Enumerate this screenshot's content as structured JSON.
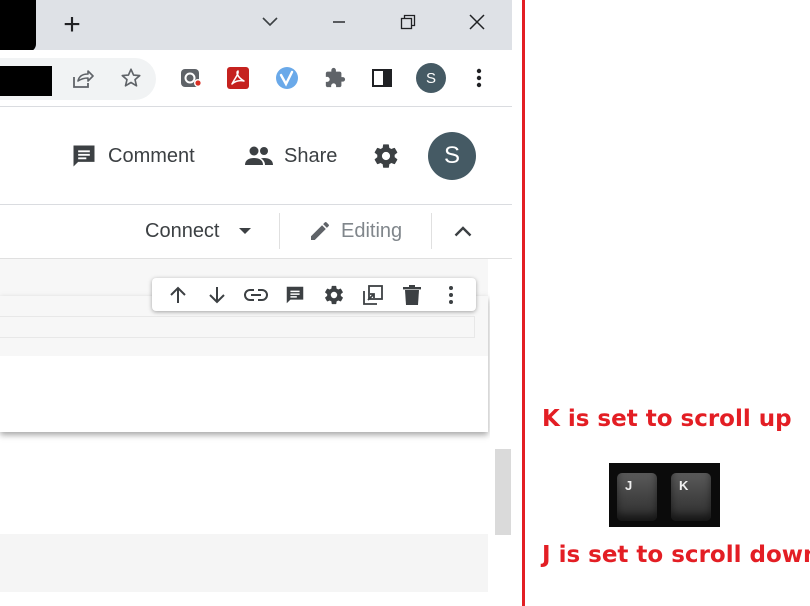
{
  "browser": {
    "new_tab_label": "+",
    "avatar_letter": "S"
  },
  "colab": {
    "comment_label": "Comment",
    "share_label": "Share",
    "avatar_letter": "S",
    "connect_label": "Connect",
    "editing_label": "Editing"
  },
  "annotation": {
    "k_text": "K is set to scroll up",
    "j_text": "J is set to scroll down",
    "key_j": "J",
    "key_k": "K",
    "line_color": "#e31e24"
  },
  "colors": {
    "avatar_bg": "#455a64",
    "tabstrip_bg": "#dee1e6"
  }
}
